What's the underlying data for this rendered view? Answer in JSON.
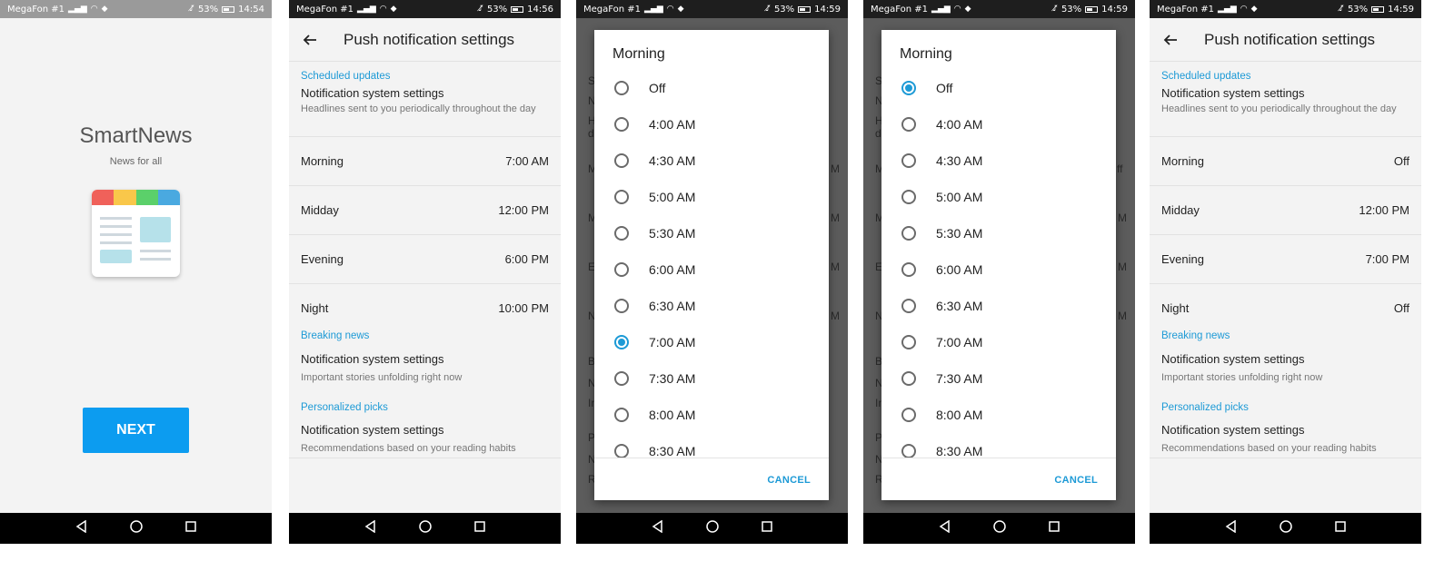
{
  "colors": {
    "accent": "#1d9ad6",
    "next_button": "#0c9cf0",
    "logo_red": "#f0615a",
    "logo_yellow": "#f9c74a",
    "logo_green": "#5bd06a",
    "logo_blue": "#4aa9e0"
  },
  "status": {
    "carrier": "MegaFon #1",
    "hd_badge": "HD",
    "battery": "53%",
    "times": [
      "14:54",
      "14:56",
      "14:59",
      "14:59",
      "14:59"
    ]
  },
  "splash": {
    "app_name": "SmartNews",
    "tagline": "News for all",
    "next_label": "NEXT"
  },
  "settings": {
    "title": "Push notification settings",
    "scheduled": {
      "header": "Scheduled updates",
      "system_settings": "Notification system settings",
      "description": "Headlines sent to you periodically throughout the day"
    },
    "slots": {
      "morning": "Morning",
      "midday": "Midday",
      "evening": "Evening",
      "night": "Night"
    },
    "values_before": {
      "morning": "7:00 AM",
      "midday": "12:00 PM",
      "evening": "6:00 PM",
      "night": "10:00 PM"
    },
    "values_after": {
      "morning": "Off",
      "midday": "12:00 PM",
      "evening": "7:00 PM",
      "night": "Off"
    },
    "breaking": {
      "header": "Breaking news",
      "system_settings": "Notification system settings",
      "description": "Important stories unfolding right now"
    },
    "personalized": {
      "header": "Personalized picks",
      "system_settings": "Notification system settings",
      "description": "Recommendations based on your reading habits"
    }
  },
  "dialog": {
    "title": "Morning",
    "options": [
      "Off",
      "4:00 AM",
      "4:30 AM",
      "5:00 AM",
      "5:30 AM",
      "6:00 AM",
      "6:30 AM",
      "7:00 AM",
      "7:30 AM",
      "8:00 AM",
      "8:30 AM"
    ],
    "selected_first": "7:00 AM",
    "selected_second": "Off",
    "cancel_label": "CANCEL"
  },
  "ghost": {
    "s": "S",
    "n": "N",
    "h": "H",
    "d": "d",
    "m": "M",
    "e": "E",
    "b": "B",
    "i": "In",
    "p": "P",
    "r": "R",
    "ff": "ff"
  }
}
